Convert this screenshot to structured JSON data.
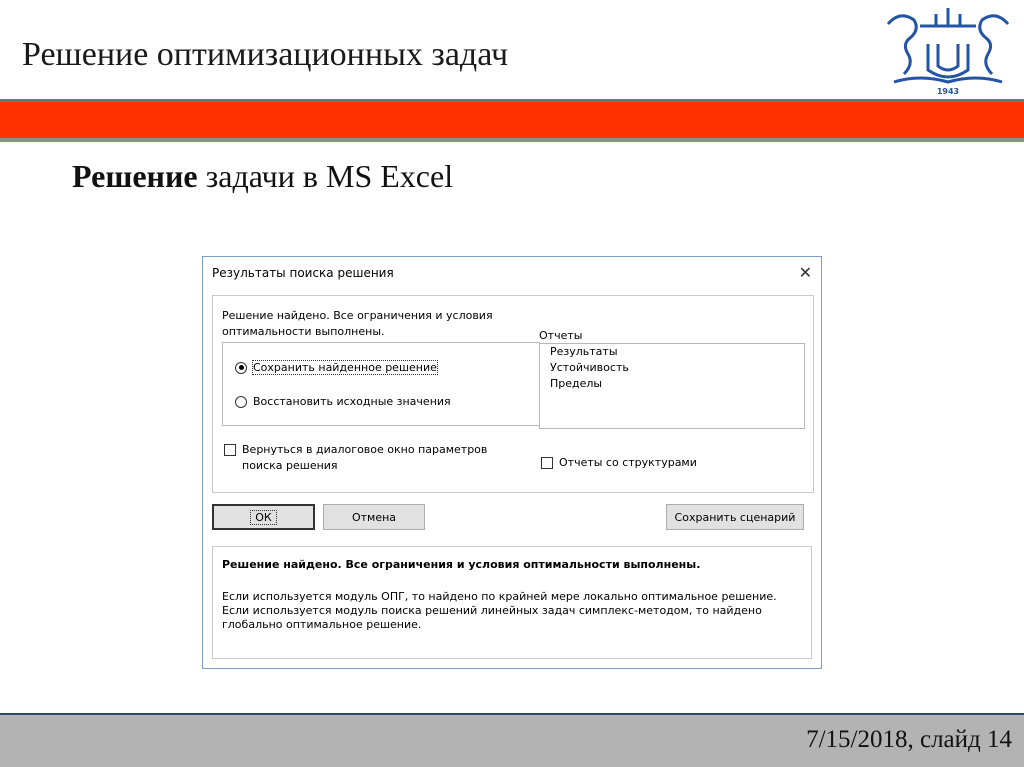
{
  "slide": {
    "title": "Решение оптимизационных задач",
    "subtitle_bold": "Решение",
    "subtitle_rest": " задачи в MS Excel",
    "footer": "7/15/2018, слайд 14",
    "logo_year": "1943",
    "colors": {
      "red_band": "#ff3300",
      "logo_blue": "#2455a5",
      "footer_gray": "#b3b3b3"
    }
  },
  "dialog": {
    "title": "Результаты поиска решения",
    "close_icon": "close-icon",
    "message_line1": "Решение найдено. Все ограничения и условия",
    "message_line2": "оптимальности выполнены.",
    "radio_keep": "Сохранить найденное решение",
    "radio_restore": "Восстановить исходные значения",
    "return_line1": "Вернуться в диалоговое окно параметров",
    "return_line2": "поиска решения",
    "reports_label": "Отчеты",
    "reports": [
      "Результаты",
      "Устойчивость",
      "Пределы"
    ],
    "outline_reports": "Отчеты со структурами",
    "ok": "ОК",
    "cancel": "Отмена",
    "save_scenario": "Сохранить сценарий",
    "result_bold": "Решение найдено. Все ограничения и условия оптимальности выполнены.",
    "result_desc": "Если используется модуль ОПГ, то найдено по крайней мере локально оптимальное решение. Если используется модуль поиска решений линейных задач симплекс-методом, то найдено глобально оптимальное решение."
  }
}
